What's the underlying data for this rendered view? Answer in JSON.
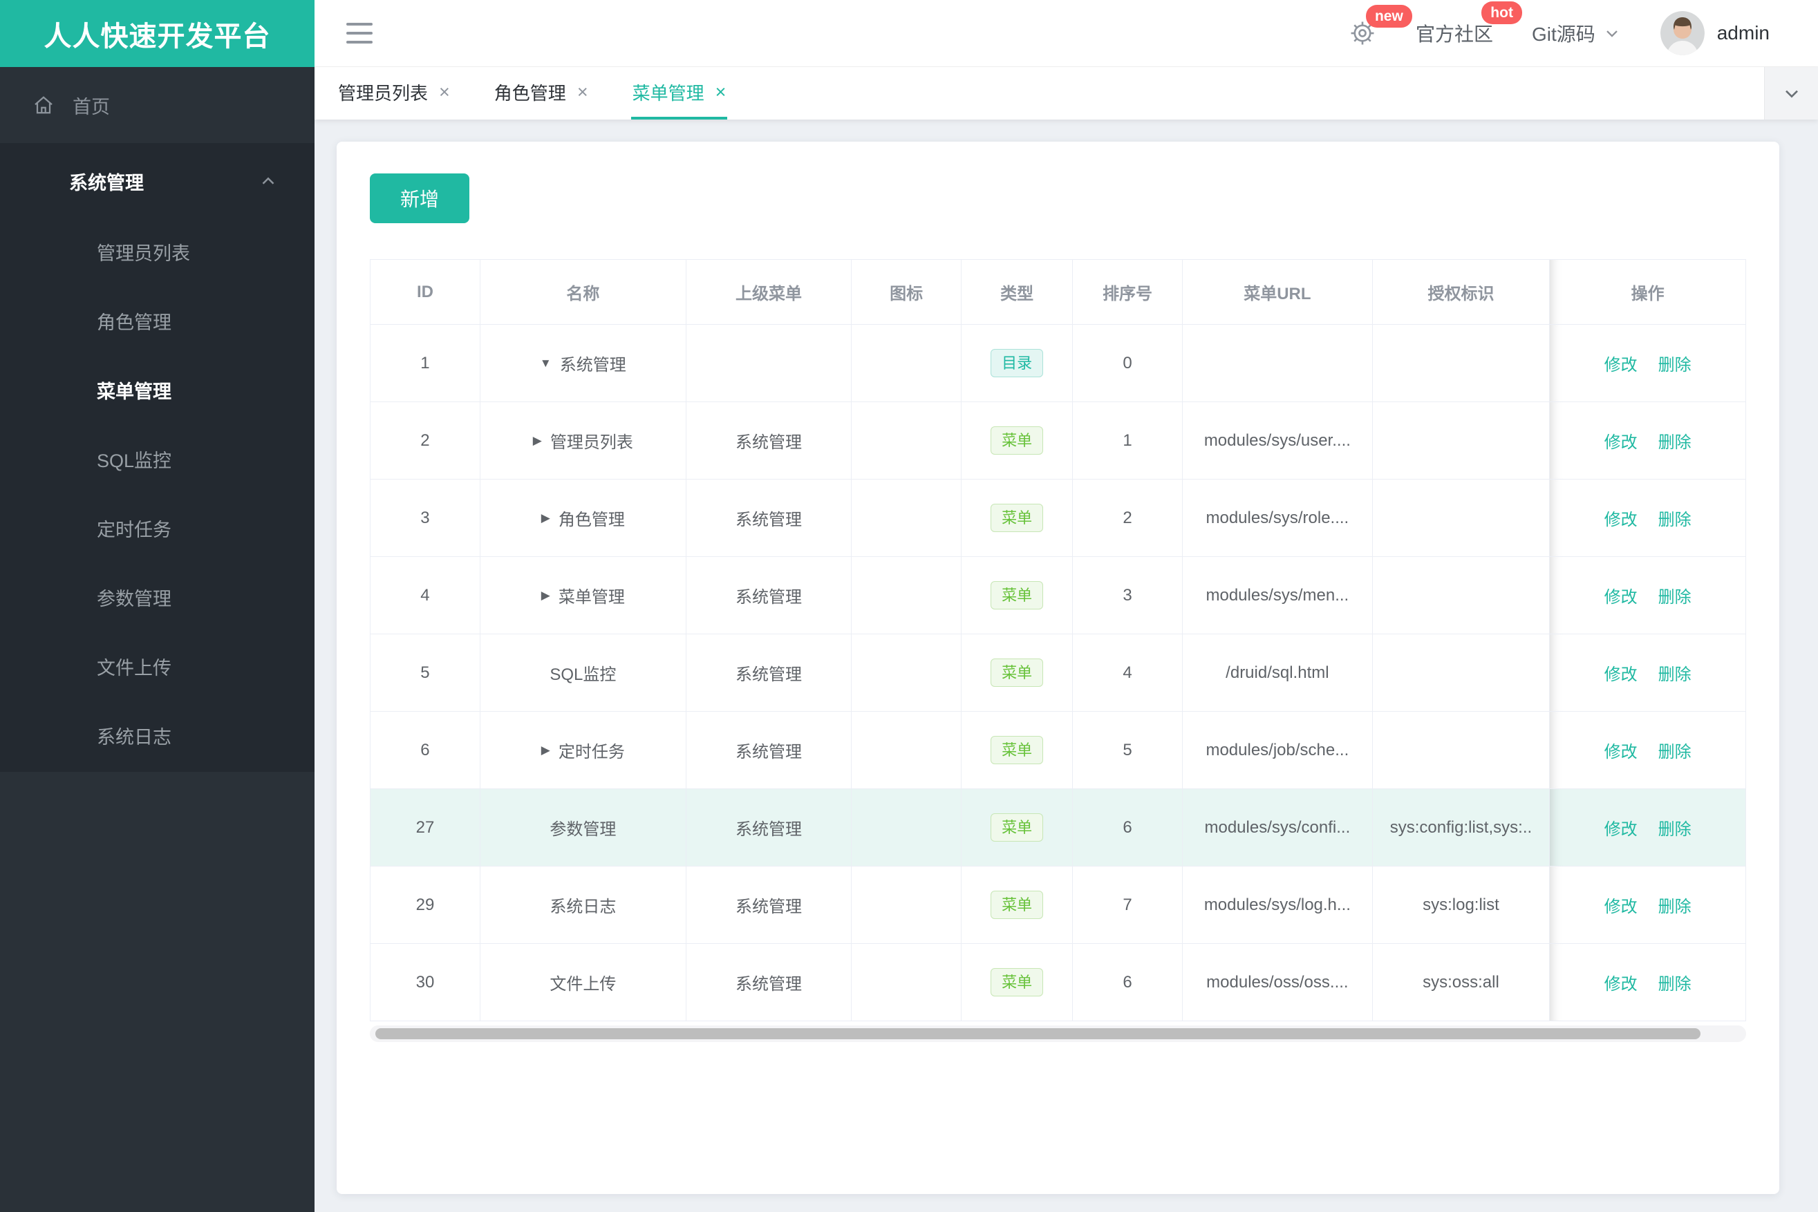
{
  "app": {
    "logo_text": "人人快速开发平台"
  },
  "topbar": {
    "badges": {
      "new": "new",
      "hot": "hot"
    },
    "community_label": "官方社区",
    "git_label": "Git源码",
    "username": "admin"
  },
  "sidebar": {
    "home_label": "首页",
    "group_label": "系统管理",
    "items": [
      {
        "label": "管理员列表",
        "active": false
      },
      {
        "label": "角色管理",
        "active": false
      },
      {
        "label": "菜单管理",
        "active": true
      },
      {
        "label": "SQL监控",
        "active": false
      },
      {
        "label": "定时任务",
        "active": false
      },
      {
        "label": "参数管理",
        "active": false
      },
      {
        "label": "文件上传",
        "active": false
      },
      {
        "label": "系统日志",
        "active": false
      }
    ]
  },
  "tabs": [
    {
      "label": "管理员列表",
      "active": false
    },
    {
      "label": "角色管理",
      "active": false
    },
    {
      "label": "菜单管理",
      "active": true
    }
  ],
  "main": {
    "add_button_label": "新增",
    "table": {
      "columns": [
        "ID",
        "名称",
        "上级菜单",
        "图标",
        "类型",
        "排序号",
        "菜单URL",
        "授权标识",
        "操作"
      ],
      "type_labels": {
        "dir": "目录",
        "menu": "菜单"
      },
      "actions": {
        "edit": "修改",
        "delete": "删除"
      },
      "rows": [
        {
          "id": "1",
          "name": "系统管理",
          "arrow": "expanded",
          "parent": "",
          "type": "dir",
          "order": "0",
          "url": "",
          "perms": "",
          "highlight": false
        },
        {
          "id": "2",
          "name": "管理员列表",
          "arrow": "collapsed",
          "parent": "系统管理",
          "type": "menu",
          "order": "1",
          "url": "modules/sys/user....",
          "perms": "",
          "highlight": false
        },
        {
          "id": "3",
          "name": "角色管理",
          "arrow": "collapsed",
          "parent": "系统管理",
          "type": "menu",
          "order": "2",
          "url": "modules/sys/role....",
          "perms": "",
          "highlight": false
        },
        {
          "id": "4",
          "name": "菜单管理",
          "arrow": "collapsed",
          "parent": "系统管理",
          "type": "menu",
          "order": "3",
          "url": "modules/sys/men...",
          "perms": "",
          "highlight": false
        },
        {
          "id": "5",
          "name": "SQL监控",
          "arrow": "none",
          "parent": "系统管理",
          "type": "menu",
          "order": "4",
          "url": "/druid/sql.html",
          "perms": "",
          "highlight": false
        },
        {
          "id": "6",
          "name": "定时任务",
          "arrow": "collapsed",
          "parent": "系统管理",
          "type": "menu",
          "order": "5",
          "url": "modules/job/sche...",
          "perms": "",
          "highlight": false
        },
        {
          "id": "27",
          "name": "参数管理",
          "arrow": "none",
          "parent": "系统管理",
          "type": "menu",
          "order": "6",
          "url": "modules/sys/confi...",
          "perms": "sys:config:list,sys:..",
          "highlight": true
        },
        {
          "id": "29",
          "name": "系统日志",
          "arrow": "none",
          "parent": "系统管理",
          "type": "menu",
          "order": "7",
          "url": "modules/sys/log.h...",
          "perms": "sys:log:list",
          "highlight": false
        },
        {
          "id": "30",
          "name": "文件上传",
          "arrow": "none",
          "parent": "系统管理",
          "type": "menu",
          "order": "6",
          "url": "modules/oss/oss....",
          "perms": "sys:oss:all",
          "highlight": false
        }
      ]
    }
  },
  "colors": {
    "accent": "#20b9a2",
    "sidebar_bg": "#2a3138",
    "sidebar_submenu_bg": "#232930",
    "badge_red": "#f95e5e",
    "row_highlight": "#e8f6f3",
    "tag_dir_text": "#1fb9a3",
    "tag_menu_text": "#67c23a",
    "table_border": "#ebeef5",
    "header_text": "#8f959e",
    "cell_text": "#5f6368"
  },
  "icons": {
    "hamburger": "menu",
    "settings": "gear",
    "home": "house",
    "dropdowns": "chevron-down",
    "group_state": "chevron-up",
    "tab_close": "x"
  }
}
